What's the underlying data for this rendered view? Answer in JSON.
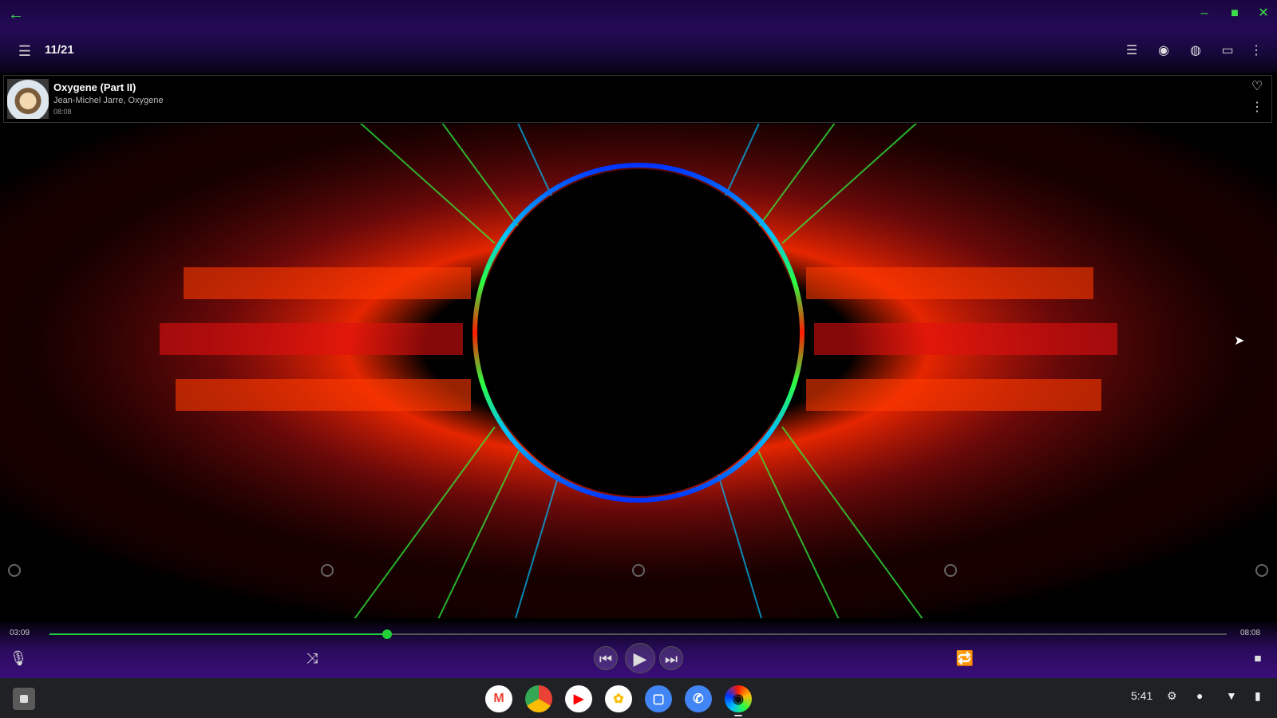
{
  "window": {
    "back_icon": "arrow-left-icon",
    "controls": [
      "minimize-icon",
      "maximize-icon",
      "close-icon"
    ]
  },
  "appbar": {
    "menu_icon": "hamburger-icon",
    "queue_counter": "11/21",
    "actions": [
      "playlist-icon",
      "eye-icon",
      "palette-icon",
      "cast-screen-icon",
      "more-vert-icon"
    ]
  },
  "track": {
    "title": "Oxygene (Part II)",
    "artist": "Jean-Michel Jarre, Oxygene",
    "duration": "08:08"
  },
  "player": {
    "elapsed": "03:09",
    "total": "08:08",
    "progress": 0.287,
    "accent_color": "#22d03a"
  },
  "presets": [
    "preset-1",
    "preset-2",
    "preset-3",
    "preset-4",
    "preset-5"
  ],
  "shelf": {
    "apps": [
      {
        "name": "gmail",
        "glyph": "M"
      },
      {
        "name": "chrome",
        "glyph": ""
      },
      {
        "name": "youtube",
        "glyph": "▶"
      },
      {
        "name": "photos",
        "glyph": "✿"
      },
      {
        "name": "messages",
        "glyph": "▢"
      },
      {
        "name": "phone",
        "glyph": "✆"
      },
      {
        "name": "music-player",
        "glyph": "◉"
      }
    ],
    "clock": "5:41"
  }
}
